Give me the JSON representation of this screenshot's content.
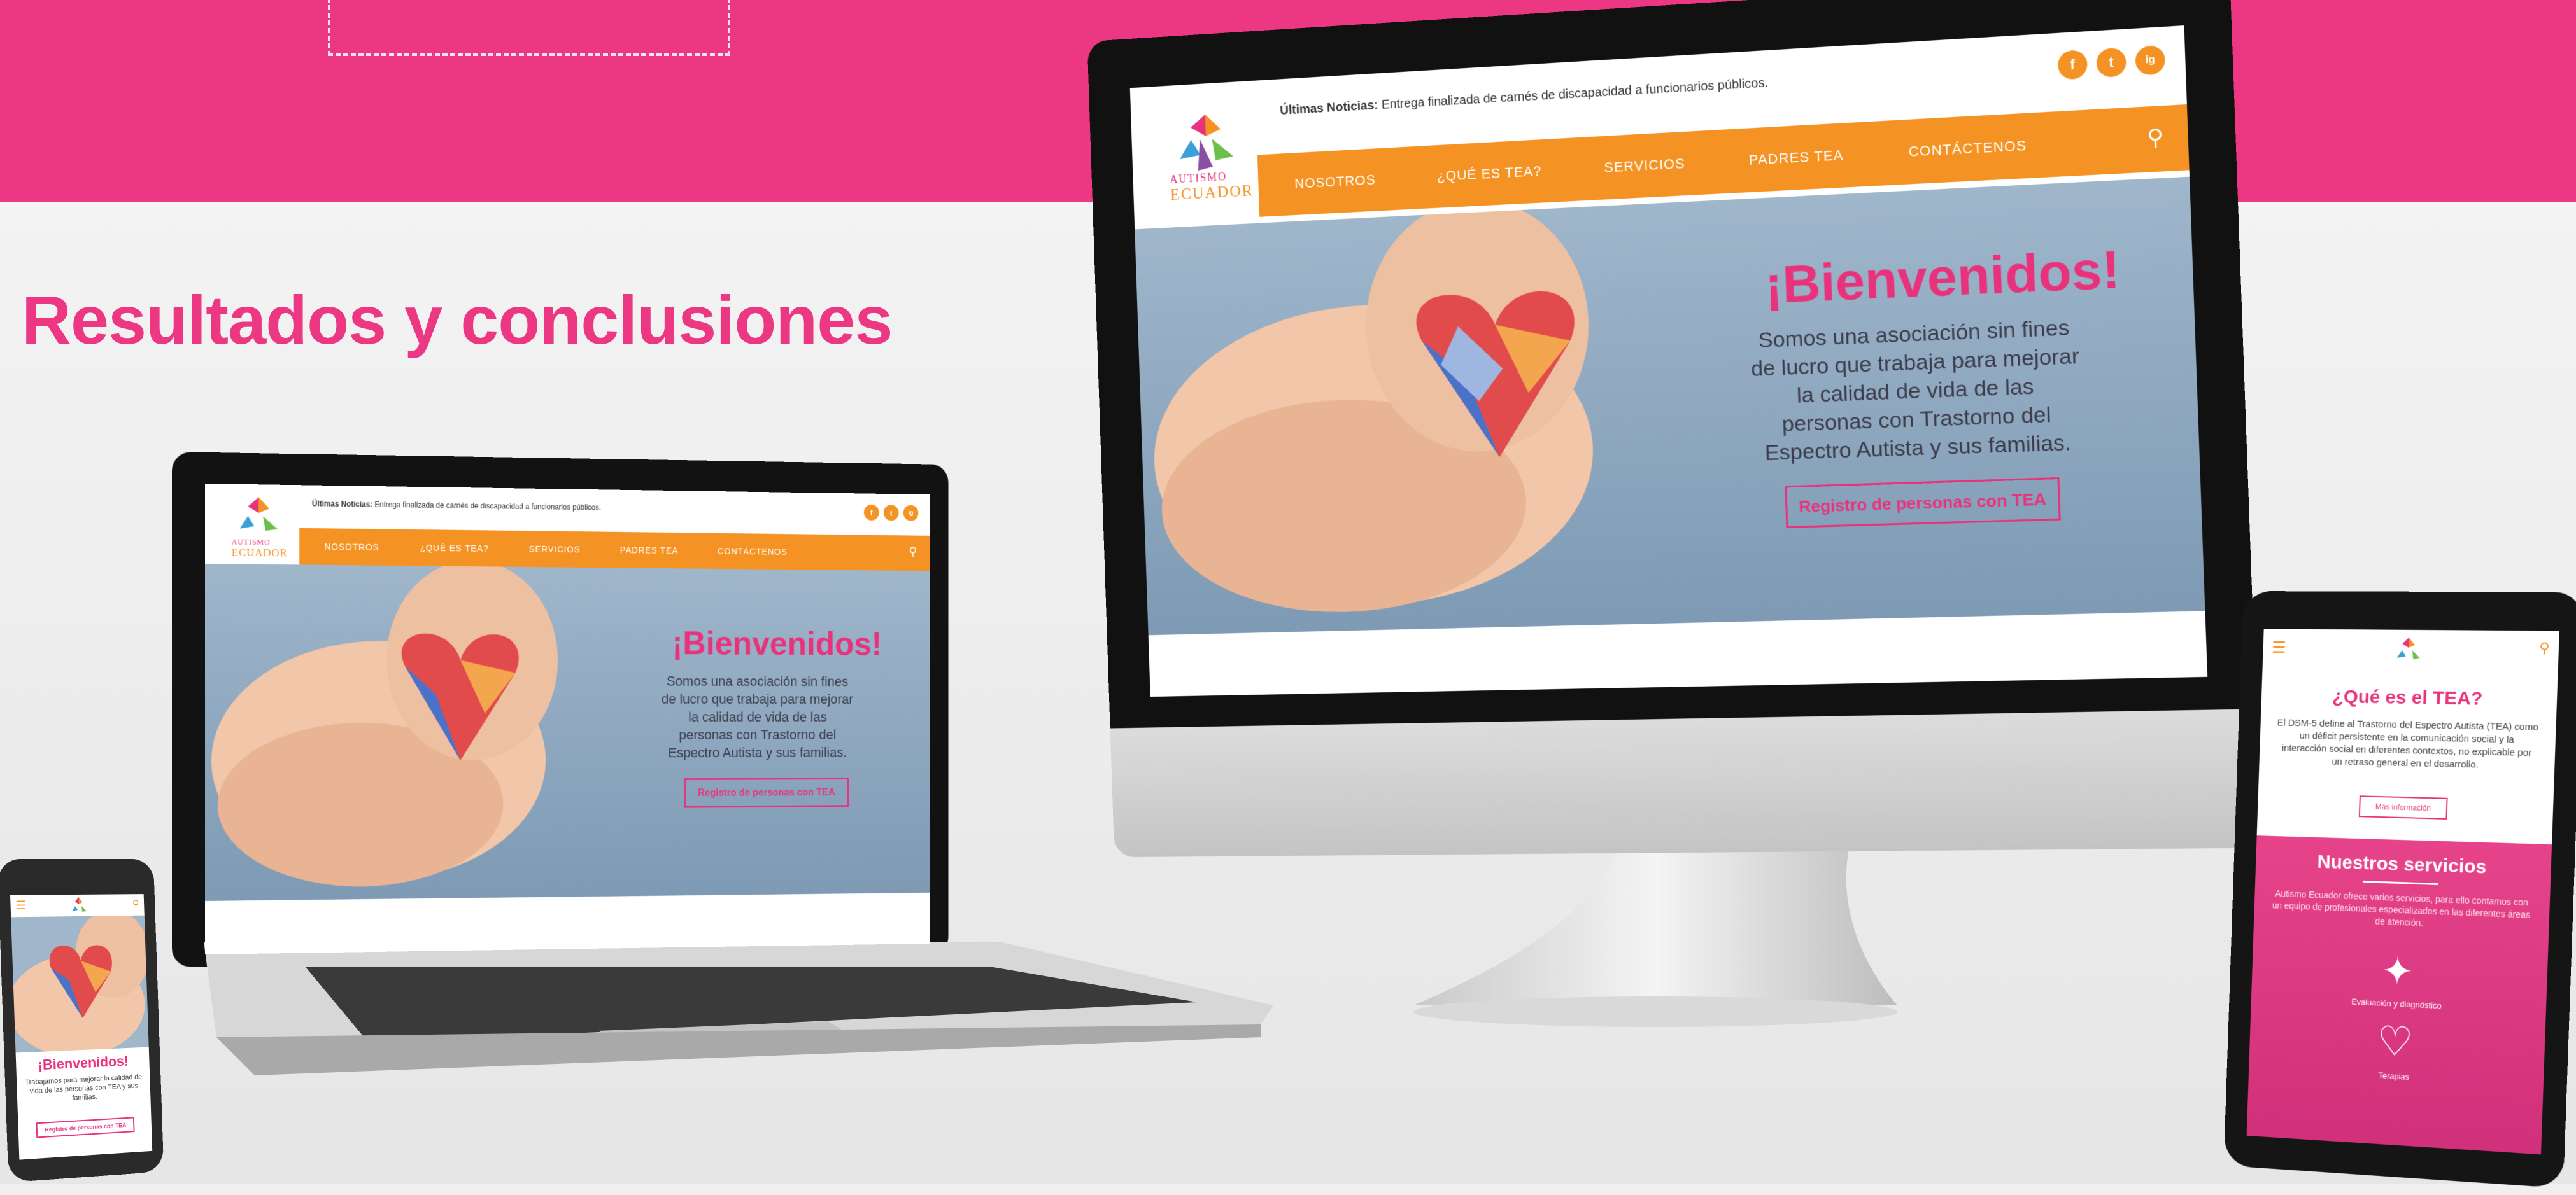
{
  "slide": {
    "headline": "Resultados y conclusiones"
  },
  "site": {
    "news_label": "Últimas Noticias:",
    "news_text": "Entrega finalizada de carnés de discapacidad a funcionarios públicos.",
    "logo_top": "AUTISMO",
    "logo_bottom": "ECUADOR",
    "nav": [
      "NOSOTROS",
      "¿QUÉ ES TEA?",
      "SERVICIOS",
      "PADRES TEA",
      "CONTÁCTENOS"
    ],
    "hero_title": "¡Bienvenidos!",
    "hero_text": "Somos una asociación sin fines de lucro que trabaja para mejorar la calidad de vida de las personas con Trastorno del Espectro Autista y sus familias.",
    "cta": "Registro de personas con TEA",
    "social": [
      "f",
      "t",
      "ig"
    ]
  },
  "phone": {
    "hero_title": "¡Bienvenidos!",
    "hero_text": "Trabajamos para mejorar la calidad de vida de las personas con TEA y sus familias.",
    "cta": "Registro de personas con TEA"
  },
  "tablet": {
    "tea_title": "¿Qué es el TEA?",
    "tea_text": "El DSM-5 define al Trastorno del Espectro Autista (TEA) como un déficit persistente en la comunicación social y la interacción social en diferentes contextos, no explicable por un retraso general en el desarrollo.",
    "tea_button": "Más información",
    "services_title": "Nuestros servicios",
    "services_text": "Autismo Ecuador ofrece varios servicios, para ello contamos con un equipo de profesionales especializados en las diferentes áreas de atención.",
    "service_1": "Evaluación y diagnóstico",
    "service_2": "Terapias"
  },
  "colors": {
    "brand_pink": "#ec3883",
    "nav_orange": "#f49223"
  }
}
